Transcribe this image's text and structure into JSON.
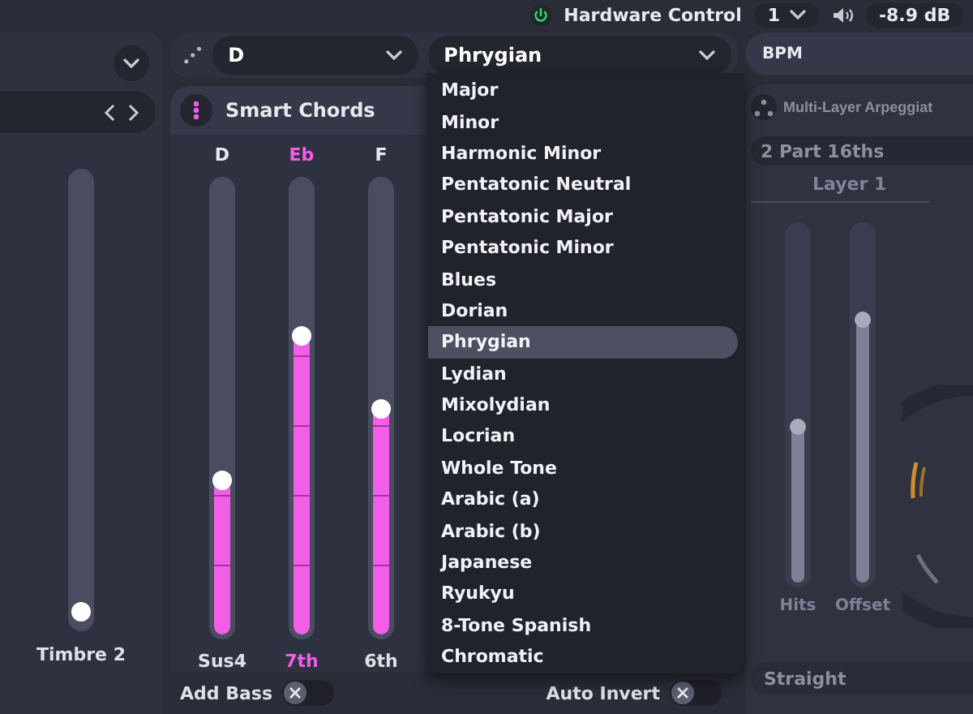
{
  "header": {
    "hardware_control": {
      "label": "Hardware Control",
      "on": true
    },
    "channel": "1",
    "volume": "-8.9 dB"
  },
  "left_panel": {
    "slider": {
      "label": "Timbre 2",
      "level": 0.02
    }
  },
  "key_select": {
    "value": "D"
  },
  "scale_select": {
    "value": "Phrygian",
    "options": [
      {
        "label": "Major",
        "selected": false
      },
      {
        "label": "Minor",
        "selected": false
      },
      {
        "label": "Harmonic Minor",
        "selected": false
      },
      {
        "label": "Pentatonic Neutral",
        "selected": false
      },
      {
        "label": "Pentatonic Major",
        "selected": false
      },
      {
        "label": "Pentatonic Minor",
        "selected": false
      },
      {
        "label": "Blues",
        "selected": false
      },
      {
        "label": "Dorian",
        "selected": false
      },
      {
        "label": "Phrygian",
        "selected": true
      },
      {
        "label": "Lydian",
        "selected": false
      },
      {
        "label": "Mixolydian",
        "selected": false
      },
      {
        "label": "Locrian",
        "selected": false
      },
      {
        "label": "Whole Tone",
        "selected": false
      },
      {
        "label": "Arabic (a)",
        "selected": false
      },
      {
        "label": "Arabic (b)",
        "selected": false
      },
      {
        "label": "Japanese",
        "selected": false
      },
      {
        "label": "Ryukyu",
        "selected": false
      },
      {
        "label": "8-Tone Spanish",
        "selected": false
      },
      {
        "label": "Chromatic",
        "selected": false
      }
    ]
  },
  "smart_chords": {
    "title": "Smart Chords",
    "columns": [
      {
        "note": "D",
        "label": "Sus4",
        "level": 0.34,
        "highlighted": false
      },
      {
        "note": "Eb",
        "label": "7th",
        "level": 0.66,
        "highlighted": true
      },
      {
        "note": "F",
        "label": "6th",
        "level": 0.5,
        "highlighted": false
      }
    ],
    "toggles": [
      {
        "label": "Add Bass",
        "on": false
      },
      {
        "label": "Auto Invert",
        "on": false
      }
    ]
  },
  "arpeggiator": {
    "bpm": "BPM",
    "title": "Multi-Layer Arpeggiat",
    "pattern": "2 Part 16ths",
    "layer": "Layer 1",
    "sliders": [
      {
        "label": "Hits",
        "level": 0.44
      },
      {
        "label": "Offset",
        "level": 0.74
      }
    ],
    "mode": "Straight"
  }
}
